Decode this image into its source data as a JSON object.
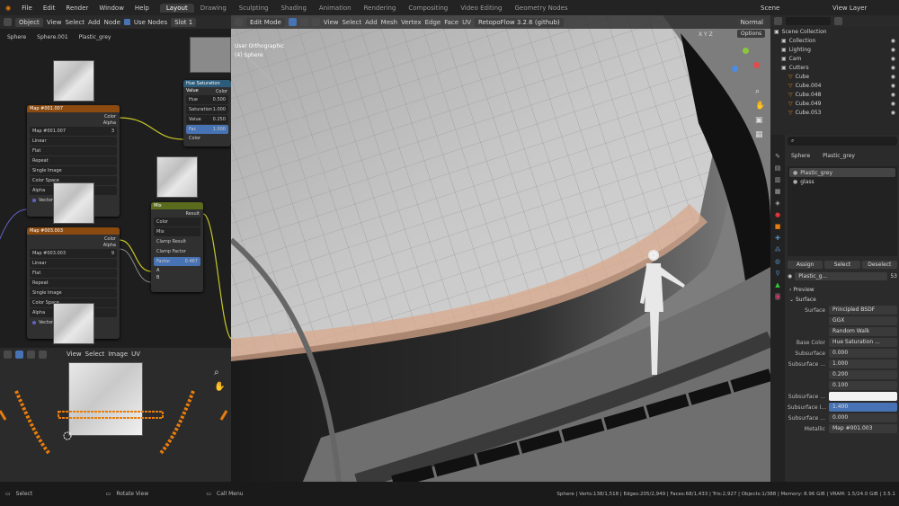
{
  "topbar": {
    "menus": [
      "File",
      "Edit",
      "Render",
      "Window",
      "Help"
    ],
    "workspaces": [
      "Layout",
      "Drawing",
      "Sculpting",
      "Shading",
      "Animation",
      "Rendering",
      "Compositing",
      "Video Editing",
      "Geometry Nodes"
    ],
    "active_workspace": "Layout",
    "scene": "Scene",
    "view_layer": "View Layer"
  },
  "node_editor": {
    "header": {
      "mode": "Object",
      "view": "View",
      "select": "Select",
      "add": "Add",
      "node": "Node",
      "use_nodes": "Use Nodes",
      "slot": "Slot 1"
    },
    "breadcrumb": [
      "Sphere",
      "Sphere.001",
      "Plastic_grey"
    ],
    "map1": {
      "title": "Map #001.007",
      "image": "Map #001.007",
      "count": "3",
      "options": [
        "Linear",
        "Flat",
        "Repeat",
        "Single Image"
      ],
      "color_space": "Color Space",
      "alpha": "Alpha",
      "vector": "Vector",
      "out_color": "Color",
      "out_alpha": "Alpha"
    },
    "map2": {
      "title": "Map #003.003",
      "image": "Map #003.003",
      "count": "9",
      "options": [
        "Linear",
        "Flat",
        "Repeat",
        "Single Image"
      ],
      "color_space": "Color Space",
      "alpha": "Alpha",
      "vector": "Vector",
      "out_color": "Color",
      "out_alpha": "Alpha"
    },
    "hsv": {
      "title": "Hue Saturation Value",
      "out": "Color",
      "rows": [
        {
          "k": "Hue",
          "v": "0.500"
        },
        {
          "k": "Saturation",
          "v": "1.000"
        },
        {
          "k": "Value",
          "v": "0.250"
        },
        {
          "k": "Fac",
          "v": "1.000"
        }
      ],
      "in": "Color"
    },
    "mix": {
      "title": "Mix",
      "result": "Result",
      "type": "Color",
      "blend": "Mix",
      "clamp_result": "Clamp Result",
      "clamp_factor": "Clamp Factor",
      "factor_label": "Factor",
      "factor": "0.467",
      "a": "A",
      "b": "B"
    }
  },
  "uv_editor": {
    "menus": [
      "View",
      "Select",
      "Image",
      "UV"
    ]
  },
  "viewport": {
    "mode": "Edit Mode",
    "menus": [
      "View",
      "Select",
      "Add",
      "Mesh",
      "Vertex",
      "Edge",
      "Face",
      "UV"
    ],
    "addon": "RetopoFlow 3.2.6 (github)",
    "orientation": "Normal",
    "view_name": "User Orthographic",
    "object_name": "(4) Sphere",
    "axes": "X Y Z",
    "options": "Options"
  },
  "outliner": {
    "root": "Scene Collection",
    "items": [
      {
        "name": "Collection",
        "depth": 1
      },
      {
        "name": "Lighting",
        "depth": 1
      },
      {
        "name": "Cam",
        "depth": 1
      },
      {
        "name": "Cutters",
        "depth": 1
      },
      {
        "name": "Cube",
        "depth": 2
      },
      {
        "name": "Cube.004",
        "depth": 2
      },
      {
        "name": "Cube.048",
        "depth": 2
      },
      {
        "name": "Cube.049",
        "depth": 2
      },
      {
        "name": "Cube.053",
        "depth": 2
      }
    ]
  },
  "properties": {
    "object": "Sphere",
    "material": "Plastic_grey",
    "slots": [
      "Plastic_grey",
      "glass"
    ],
    "assign": "Assign",
    "select": "Select",
    "deselect": "Deselect",
    "mat_name": "Plastic_g...",
    "users": "53",
    "preview": "Preview",
    "surface_section": "Surface",
    "rows": [
      {
        "k": "Surface",
        "v": "Principled BSDF"
      },
      {
        "k": "",
        "v": "GGX"
      },
      {
        "k": "",
        "v": "Random Walk"
      },
      {
        "k": "Base Color",
        "v": "Hue Saturation ..."
      },
      {
        "k": "Subsurface",
        "v": "0.000"
      },
      {
        "k": "Subsurface ...",
        "v": "1.000"
      },
      {
        "k": "",
        "v": "0.200"
      },
      {
        "k": "",
        "v": "0.100"
      },
      {
        "k": "Subsurface ...",
        "v": ""
      },
      {
        "k": "Subsurface I...",
        "v": "1.400"
      },
      {
        "k": "Subsurface ...",
        "v": "0.000"
      },
      {
        "k": "Metallic",
        "v": "Map #001.003"
      }
    ]
  },
  "statusbar": {
    "left": [
      "Select",
      "Rotate View",
      "Call Menu"
    ],
    "right": "Sphere | Verts:138/1,518 | Edges:205/2,949 | Faces:68/1,433 | Tris:2,927 | Objects:1/388 | Memory: 8.96 GiB | VRAM: 1.5/24.0 GiB | 3.5.1"
  },
  "colors": {
    "accent": "#4772b3",
    "node_image": "#8a4a10",
    "node_color": "#5a6b1d",
    "node_converter": "#2d5b7a",
    "uv_orange": "#e87d0d"
  }
}
